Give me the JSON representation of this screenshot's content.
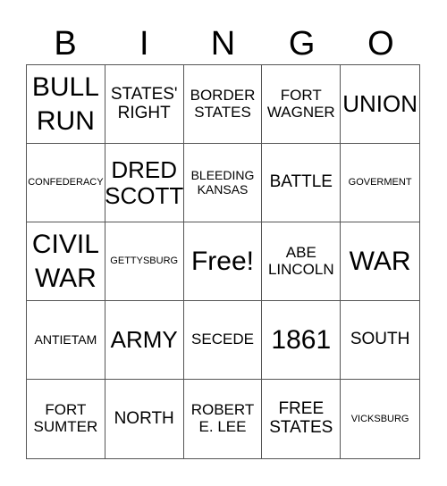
{
  "header": {
    "letters": [
      "B",
      "I",
      "N",
      "G",
      "O"
    ]
  },
  "cells": [
    "BULL RUN",
    "STATES' RIGHT",
    "BORDER STATES",
    "FORT WAGNER",
    "UNION",
    "CONFEDERACY",
    "DRED SCOTT",
    "BLEEDING KANSAS",
    "BATTLE",
    "GOVERMENT",
    "CIVIL WAR",
    "GETTYSBURG",
    "Free!",
    "ABE LINCOLN",
    "WAR",
    "ANTIETAM",
    "ARMY",
    "SECEDE",
    "1861",
    "SOUTH",
    "FORT SUMTER",
    "NORTH",
    "ROBERT E. LEE",
    "FREE STATES",
    "VICKSBURG"
  ]
}
